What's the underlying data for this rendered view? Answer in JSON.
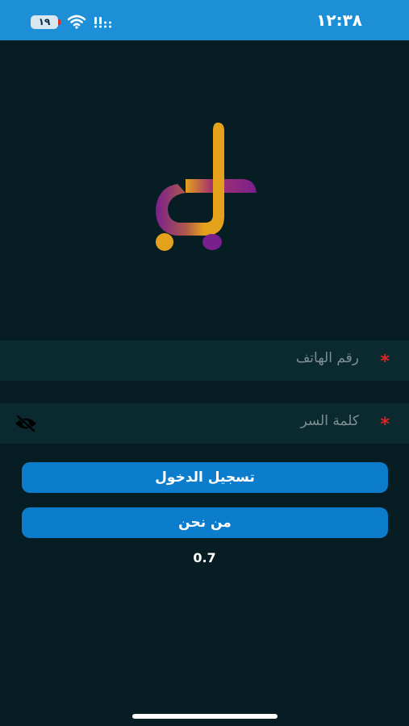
{
  "status_bar": {
    "time": "١٢:٣٨",
    "battery_level": "١٩",
    "background_color": "#1c8fd6",
    "icons": [
      "battery-icon",
      "wifi-icon",
      "cellular-signal-icon"
    ]
  },
  "logo": {
    "icon": "brand-logo",
    "colors": [
      "#e4a11b",
      "#7a1f8e"
    ]
  },
  "form": {
    "phone_placeholder": "رقم الهاتف",
    "password_placeholder": "كلمة السر",
    "required_marker": "*",
    "password_toggle_icon": "eye-slash-icon"
  },
  "buttons": {
    "login_label": "تسجيل الدخول",
    "about_label": "من نحن",
    "color": "#0c7ccc"
  },
  "version": "0.7",
  "theme": {
    "background": "#061e23",
    "field_background": "#0a2a2f",
    "required_color": "#e52222"
  }
}
